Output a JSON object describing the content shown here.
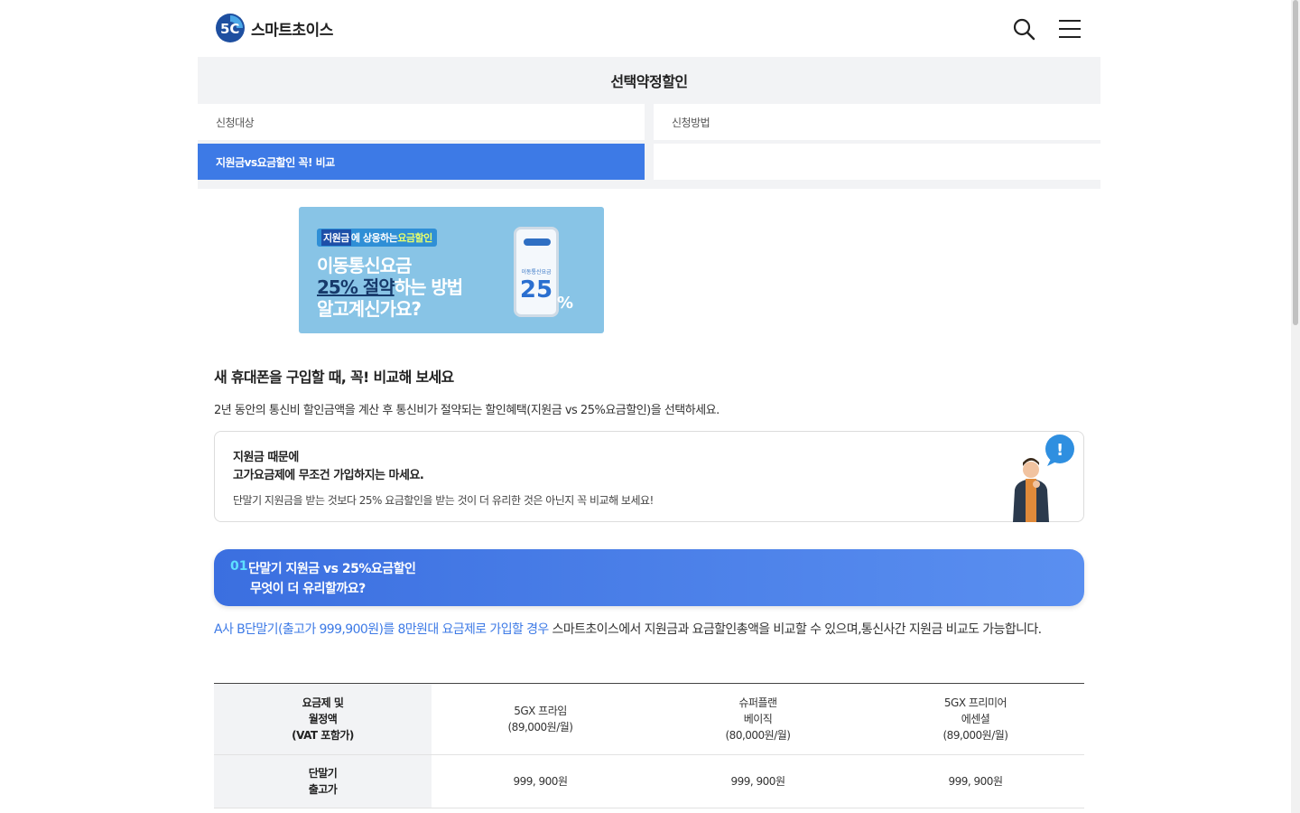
{
  "brand": {
    "name": "스마트초이스",
    "accent": "#3d7ae6"
  },
  "header": {
    "search_icon": "search-icon",
    "menu_icon": "hamburger-menu-icon"
  },
  "page_title": "선택약정할인",
  "subtabs": [
    {
      "label": "신청대상",
      "active": false
    },
    {
      "label": "신청방법",
      "active": false
    },
    {
      "label": "지원금vs요금할인 꼭! 비교",
      "active": true
    }
  ],
  "banner": {
    "chip_part1": "지원금",
    "chip_part2": "에 상응하는 ",
    "chip_part3": "요금할인",
    "line1": "이동통신요금",
    "line2_a": "25% 절약",
    "line2_b": "하는 방법",
    "line3": "알고계신가요?",
    "phone_label": "이동통신요금",
    "phone_number": "25",
    "percent": "%"
  },
  "section": {
    "heading": "새 휴대폰을 구입할 때, 꼭! 비교해 보세요",
    "desc": "2년 동안의 통신비 할인금액을 계산 후 통신비가 절약되는 할인혜택(지원금 vs 25%요금할인)을 선택하세요."
  },
  "notice": {
    "line1": "지원금 때문에",
    "line2": "고가요금제에 무조건 가입하지는 마세요.",
    "line3": "단말기 지원금을 받는 것보다 25% 요금할인을 받는 것이 더 유리한 것은 아닌지 꼭 비교해 보세요!",
    "badge": "!"
  },
  "step": {
    "number": "01",
    "title_line1": "단말기 지원금 vs 25%요금할인",
    "title_line2": "무엇이 더 유리할까요?"
  },
  "step_desc": {
    "highlight": "A사 B단말기(출고가 999,900원)를 8만원대 요금제로 가입할 경우",
    "rest": " 스마트초이스에서 지원금과 요금할인총액을 비교할 수 있으며,통신사간 지원금 비교도 가능합니다."
  },
  "table": {
    "header_label": [
      "요금제 및",
      "월정액",
      "(VAT 포함가)"
    ],
    "plans": [
      {
        "line1": "5GX 프라임",
        "line2": "(89,000원/월)",
        "line3": ""
      },
      {
        "line1": "슈퍼플랜",
        "line2": "베이직",
        "line3": "(80,000원/월)"
      },
      {
        "line1": "5GX 프리미어",
        "line2": "에센셜",
        "line3": "(89,000원/월)"
      }
    ],
    "row2_label": [
      "단말기",
      "출고가"
    ],
    "row2_values": [
      "999, 900원",
      "999, 900원",
      "999, 900원"
    ]
  }
}
